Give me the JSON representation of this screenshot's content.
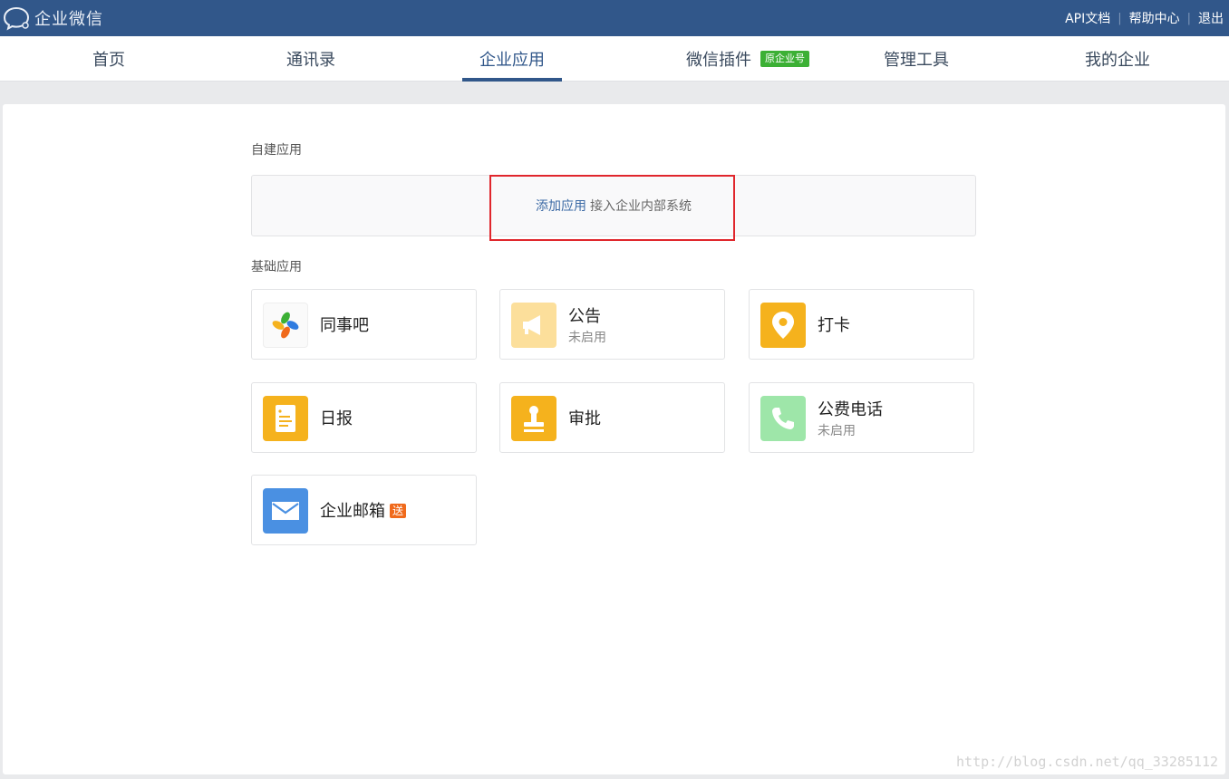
{
  "header": {
    "brand": "企业微信",
    "links": [
      "API文档",
      "帮助中心",
      "退出"
    ]
  },
  "nav": {
    "items": [
      "首页",
      "通讯录",
      "企业应用",
      "微信插件",
      "管理工具",
      "我的企业"
    ],
    "active_index": 2,
    "plugin_badge": "原企业号"
  },
  "main": {
    "custom_section_title": "自建应用",
    "add_app_link": "添加应用",
    "add_app_desc": "接入企业内部系统",
    "basic_section_title": "基础应用",
    "apps": [
      {
        "name": "同事吧",
        "status": "",
        "icon": "tongshiba-icon"
      },
      {
        "name": "公告",
        "status": "未启用",
        "icon": "megaphone-icon"
      },
      {
        "name": "打卡",
        "status": "",
        "icon": "location-pin-icon"
      },
      {
        "name": "日报",
        "status": "",
        "icon": "report-icon"
      },
      {
        "name": "审批",
        "status": "",
        "icon": "stamp-icon"
      },
      {
        "name": "公费电话",
        "status": "未启用",
        "icon": "phone-icon"
      },
      {
        "name": "企业邮箱",
        "status": "",
        "badge": "送",
        "icon": "mail-icon"
      }
    ]
  },
  "watermark": "http://blog.csdn.net/qq_33285112",
  "colors": {
    "topbar": "#31578a",
    "accent_green": "#3cb035",
    "highlight_red": "#e0262c",
    "icon_yellow": "#f5b21d",
    "icon_yellow_light": "#fcdf9b",
    "icon_green_light": "#9ee6a9",
    "icon_blue": "#4a90e2",
    "badge_orange": "#f06a1c"
  }
}
